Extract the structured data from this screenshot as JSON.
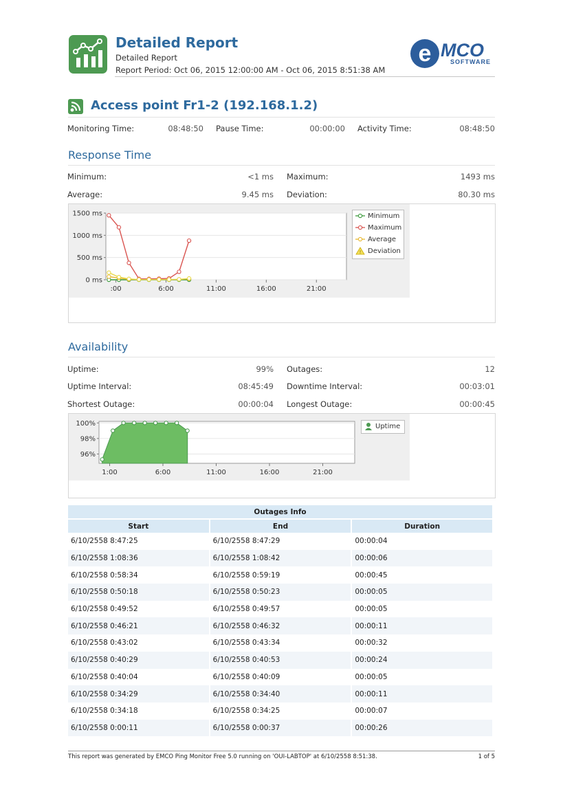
{
  "header": {
    "title": "Detailed Report",
    "subtitle": "Detailed Report",
    "period": "Report Period: Oct 06, 2015 12:00:00 AM - Oct 06, 2015 8:51:38 AM",
    "brand_e": "e",
    "brand_mco": "MCO",
    "brand_software": "SOFTWARE"
  },
  "access_point": {
    "title": "Access point Fr1-2 (192.168.1.2)",
    "monitoring_label": "Monitoring Time:",
    "monitoring_value": "08:48:50",
    "pause_label": "Pause Time:",
    "pause_value": "00:00:00",
    "activity_label": "Activity Time:",
    "activity_value": "08:48:50"
  },
  "response": {
    "title": "Response Time",
    "min_label": "Minimum:",
    "min_value": "<1 ms",
    "max_label": "Maximum:",
    "max_value": "1493 ms",
    "avg_label": "Average:",
    "avg_value": "9.45 ms",
    "dev_label": "Deviation:",
    "dev_value": "80.30 ms"
  },
  "availability": {
    "title": "Availability",
    "uptime_label": "Uptime:",
    "uptime_value": "99%",
    "outages_label": "Outages:",
    "outages_value": "12",
    "uptime_interval_label": "Uptime Interval:",
    "uptime_interval_value": "08:45:49",
    "downtime_interval_label": "Downtime Interval:",
    "downtime_interval_value": "00:03:01",
    "shortest_label": "Shortest Outage:",
    "shortest_value": "00:00:04",
    "longest_label": "Longest Outage:",
    "longest_value": "00:00:45"
  },
  "chart_data": [
    {
      "type": "line",
      "x_tick_labels": [
        ":00",
        "6:00",
        "11:00",
        "16:00",
        "21:00"
      ],
      "x_ticks_hours": [
        1,
        6,
        11,
        16,
        21
      ],
      "y_tick_labels": [
        "1500 ms",
        "1000 ms",
        "500 ms",
        "0 ms"
      ],
      "y_ticks": [
        1500,
        1000,
        500,
        0
      ],
      "xlim": [
        0,
        24
      ],
      "ylim": [
        0,
        1500
      ],
      "legend_position": "right",
      "series": [
        {
          "name": "Minimum",
          "color": "#3c9a3c",
          "x": [
            0.3,
            1.3,
            2.3,
            3.3,
            4.3,
            5.3,
            6.3,
            7.3,
            8.3
          ],
          "values": [
            0,
            0,
            0,
            0,
            0,
            0,
            0,
            0,
            0
          ]
        },
        {
          "name": "Maximum",
          "color": "#d9534f",
          "x": [
            0.3,
            1.3,
            2.3,
            3.3,
            4.3,
            5.3,
            6.3,
            7.3,
            8.3
          ],
          "values": [
            1450,
            1180,
            380,
            20,
            20,
            25,
            30,
            180,
            880
          ]
        },
        {
          "name": "Average",
          "color": "#e8b830",
          "x": [
            0.3,
            1.3,
            2.3,
            3.3,
            4.3,
            5.3,
            6.3,
            7.3,
            8.3
          ],
          "values": [
            70,
            40,
            10,
            5,
            5,
            5,
            5,
            10,
            20
          ]
        },
        {
          "name": "Deviation",
          "color": "#e8d84a",
          "x": [
            0.3,
            1.3,
            2.3,
            3.3,
            4.3,
            5.3,
            6.3,
            7.3,
            8.3
          ],
          "values": [
            160,
            60,
            20,
            5,
            5,
            5,
            5,
            10,
            30
          ]
        }
      ]
    },
    {
      "type": "area",
      "x_tick_labels": [
        "1:00",
        "6:00",
        "11:00",
        "16:00",
        "21:00"
      ],
      "x_ticks_hours": [
        1,
        6,
        11,
        16,
        21
      ],
      "y_tick_labels": [
        "100%",
        "98%",
        "96%"
      ],
      "y_ticks": [
        100,
        98,
        96
      ],
      "xlim": [
        0,
        24
      ],
      "ylim": [
        94.8,
        100.2
      ],
      "legend_position": "right",
      "series": [
        {
          "name": "Uptime",
          "color": "#6dbd63",
          "x": [
            0.3,
            1.3,
            2.3,
            3.3,
            4.3,
            5.3,
            6.3,
            7.3,
            8.3
          ],
          "values": [
            95.3,
            99.0,
            100,
            100,
            100,
            100,
            100,
            100,
            99.0
          ]
        }
      ]
    }
  ],
  "outages": {
    "caption": "Outages Info",
    "columns": [
      "Start",
      "End",
      "Duration"
    ],
    "rows": [
      [
        "6/10/2558 8:47:25",
        "6/10/2558 8:47:29",
        "00:00:04"
      ],
      [
        "6/10/2558 1:08:36",
        "6/10/2558 1:08:42",
        "00:00:06"
      ],
      [
        "6/10/2558 0:58:34",
        "6/10/2558 0:59:19",
        "00:00:45"
      ],
      [
        "6/10/2558 0:50:18",
        "6/10/2558 0:50:23",
        "00:00:05"
      ],
      [
        "6/10/2558 0:49:52",
        "6/10/2558 0:49:57",
        "00:00:05"
      ],
      [
        "6/10/2558 0:46:21",
        "6/10/2558 0:46:32",
        "00:00:11"
      ],
      [
        "6/10/2558 0:43:02",
        "6/10/2558 0:43:34",
        "00:00:32"
      ],
      [
        "6/10/2558 0:40:29",
        "6/10/2558 0:40:53",
        "00:00:24"
      ],
      [
        "6/10/2558 0:40:04",
        "6/10/2558 0:40:09",
        "00:00:05"
      ],
      [
        "6/10/2558 0:34:29",
        "6/10/2558 0:34:40",
        "00:00:11"
      ],
      [
        "6/10/2558 0:34:18",
        "6/10/2558 0:34:25",
        "00:00:07"
      ],
      [
        "6/10/2558 0:00:11",
        "6/10/2558 0:00:37",
        "00:00:26"
      ]
    ]
  },
  "footer": {
    "text": "This report was generated by EMCO Ping Monitor Free 5.0 running on 'OUI-LABTOP' at 6/10/2558 8:51:38.",
    "page": "1 of 5"
  }
}
